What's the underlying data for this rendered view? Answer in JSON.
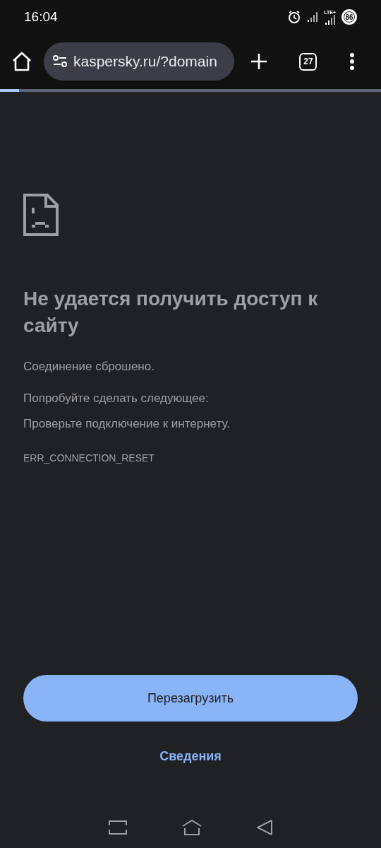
{
  "status_bar": {
    "time": "16:04",
    "network_label": "LTE+",
    "battery": "86"
  },
  "toolbar": {
    "url": "kaspersky.ru/?domain",
    "tab_count": "27"
  },
  "page_load": {
    "level": 0.05
  },
  "error": {
    "title": "Не удается получить доступ к сайту",
    "message": "Соединение сброшено.",
    "suggestions_heading": "Попробуйте сделать следующее:",
    "suggestions": [
      "Проверьте подключение к интернету."
    ],
    "code": "ERR_CONNECTION_RESET"
  },
  "buttons": {
    "reload": "Перезагрузить",
    "details": "Сведения"
  }
}
